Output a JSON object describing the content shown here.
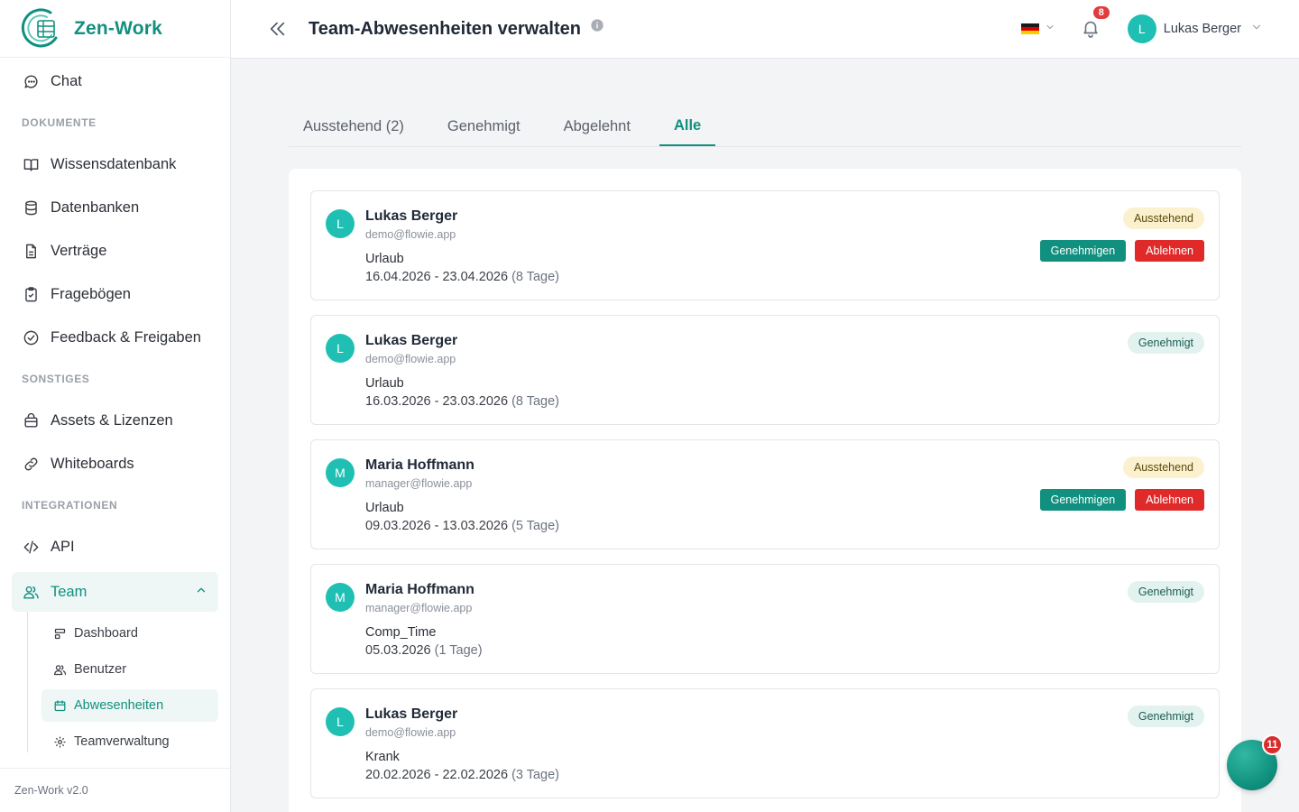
{
  "brand": {
    "name": "Zen-Work",
    "accent": "#11907f"
  },
  "sidebar": {
    "chat": "Chat",
    "sections": {
      "documents": "DOKUMENTE",
      "other": "SONSTIGES",
      "integrations": "INTEGRATIONEN"
    },
    "documents_items": [
      {
        "label": "Wissensdatenbank",
        "icon": "book-icon"
      },
      {
        "label": "Datenbanken",
        "icon": "database-icon"
      },
      {
        "label": "Verträge",
        "icon": "file-icon"
      },
      {
        "label": "Fragebögen",
        "icon": "clipboard-check-icon"
      },
      {
        "label": "Feedback & Freigaben",
        "icon": "check-circle-icon"
      }
    ],
    "other_items": [
      {
        "label": "Assets & Lizenzen",
        "icon": "package-icon"
      },
      {
        "label": "Whiteboards",
        "icon": "link-icon"
      }
    ],
    "api": "API",
    "team": {
      "label": "Team",
      "expanded": true,
      "sub_items": [
        {
          "label": "Dashboard",
          "icon": "dashboard-icon"
        },
        {
          "label": "Benutzer",
          "icon": "users-icon"
        },
        {
          "label": "Abwesenheiten",
          "icon": "calendar-icon",
          "active": true
        },
        {
          "label": "Teamverwaltung",
          "icon": "gear-icon"
        }
      ]
    },
    "version": "Zen-Work v2.0"
  },
  "header": {
    "title": "Team-Abwesenheiten verwalten",
    "language": "de",
    "notifications_count": "8",
    "user": {
      "initial": "L",
      "name": "Lukas Berger"
    }
  },
  "tabs": [
    {
      "label": "Ausstehend (2)",
      "active": false
    },
    {
      "label": "Genehmigt",
      "active": false
    },
    {
      "label": "Abgelehnt",
      "active": false
    },
    {
      "label": "Alle",
      "active": true
    }
  ],
  "requests": [
    {
      "initial": "L",
      "name": "Lukas Berger",
      "email": "demo@flowie.app",
      "type": "Urlaub",
      "dates": "16.04.2026 - 23.04.2026",
      "days": "(8 Tage)",
      "status": "Ausstehend",
      "status_kind": "pending",
      "approve_label": "Genehmigen",
      "reject_label": "Ablehnen"
    },
    {
      "initial": "L",
      "name": "Lukas Berger",
      "email": "demo@flowie.app",
      "type": "Urlaub",
      "dates": "16.03.2026 - 23.03.2026",
      "days": "(8 Tage)",
      "status": "Genehmigt",
      "status_kind": "approved"
    },
    {
      "initial": "M",
      "name": "Maria Hoffmann",
      "email": "manager@flowie.app",
      "type": "Urlaub",
      "dates": "09.03.2026 - 13.03.2026",
      "days": "(5 Tage)",
      "status": "Ausstehend",
      "status_kind": "pending",
      "approve_label": "Genehmigen",
      "reject_label": "Ablehnen"
    },
    {
      "initial": "M",
      "name": "Maria Hoffmann",
      "email": "manager@flowie.app",
      "type": "Comp_Time",
      "dates": "05.03.2026",
      "days": "(1 Tage)",
      "status": "Genehmigt",
      "status_kind": "approved"
    },
    {
      "initial": "L",
      "name": "Lukas Berger",
      "email": "demo@flowie.app",
      "type": "Krank",
      "dates": "20.02.2026 - 22.02.2026",
      "days": "(3 Tage)",
      "status": "Genehmigt",
      "status_kind": "approved"
    }
  ],
  "fab": {
    "badge": "11",
    "icon": "chat-bubble-icon"
  }
}
